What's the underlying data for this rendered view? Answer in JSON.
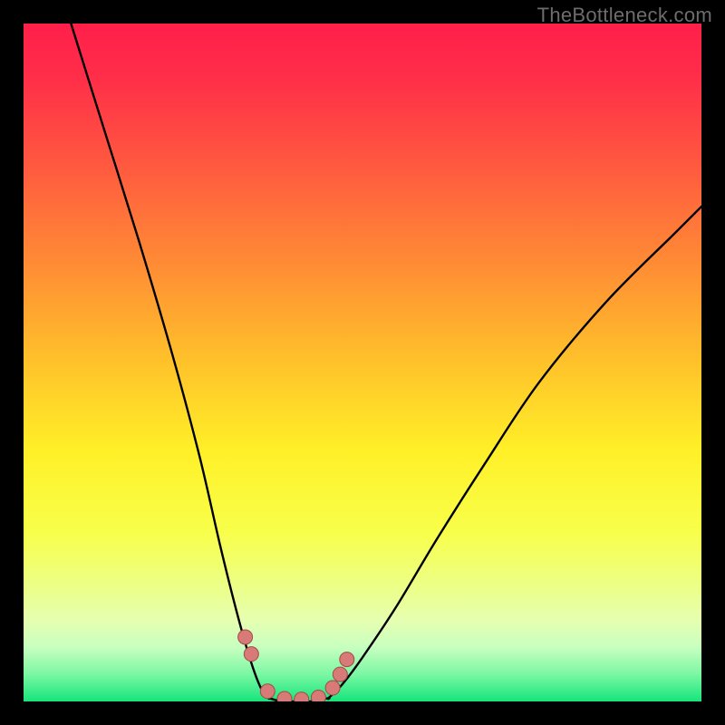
{
  "watermark": "TheBottleneck.com",
  "colors": {
    "frame": "#000000",
    "curve_stroke": "#000000",
    "marker_fill": "#d87a78",
    "marker_stroke": "#a24b49",
    "gradient_stops": [
      {
        "offset": 0.0,
        "color": "#ff1f4a"
      },
      {
        "offset": 0.08,
        "color": "#ff2e49"
      },
      {
        "offset": 0.2,
        "color": "#ff5640"
      },
      {
        "offset": 0.35,
        "color": "#ff8a35"
      },
      {
        "offset": 0.5,
        "color": "#ffc22a"
      },
      {
        "offset": 0.63,
        "color": "#fff028"
      },
      {
        "offset": 0.75,
        "color": "#f8ff4a"
      },
      {
        "offset": 0.83,
        "color": "#ecff87"
      },
      {
        "offset": 0.88,
        "color": "#e6ffb0"
      },
      {
        "offset": 0.92,
        "color": "#c8ffc0"
      },
      {
        "offset": 0.96,
        "color": "#7bf7a3"
      },
      {
        "offset": 1.0,
        "color": "#15e57c"
      }
    ]
  },
  "chart_data": {
    "type": "line",
    "title": "",
    "xlabel": "",
    "ylabel": "",
    "xlim": [
      0,
      100
    ],
    "ylim": [
      0,
      100
    ],
    "note": "Axes are unlabeled in source image; x/y values are pixel-fractions ×100 of the plot area (0..100). Curve trajectory and marker positions estimated from pixels.",
    "series": [
      {
        "name": "left-branch",
        "x": [
          7.0,
          12.0,
          17.0,
          22.0,
          26.0,
          29.0,
          31.5,
          33.5,
          35.0,
          36.2
        ],
        "y": [
          100.0,
          84.0,
          68.0,
          51.0,
          36.0,
          23.0,
          13.0,
          6.0,
          2.0,
          0.5
        ]
      },
      {
        "name": "valley",
        "x": [
          36.2,
          38.0,
          40.0,
          42.5,
          45.0
        ],
        "y": [
          0.5,
          0.0,
          0.0,
          0.0,
          0.5
        ]
      },
      {
        "name": "right-branch",
        "x": [
          45.0,
          47.0,
          50.0,
          55.0,
          61.0,
          68.0,
          76.0,
          86.0,
          96.0,
          100.0
        ],
        "y": [
          0.5,
          2.5,
          6.5,
          14.0,
          24.0,
          35.0,
          47.0,
          59.0,
          69.0,
          73.0
        ]
      }
    ],
    "markers": {
      "name": "highlight-dots",
      "x": [
        32.7,
        33.6,
        36.0,
        38.5,
        41.0,
        43.5,
        45.6,
        46.7,
        47.7
      ],
      "y": [
        9.5,
        7.0,
        1.5,
        0.4,
        0.3,
        0.6,
        2.0,
        4.0,
        6.2
      ],
      "r": 8
    }
  }
}
